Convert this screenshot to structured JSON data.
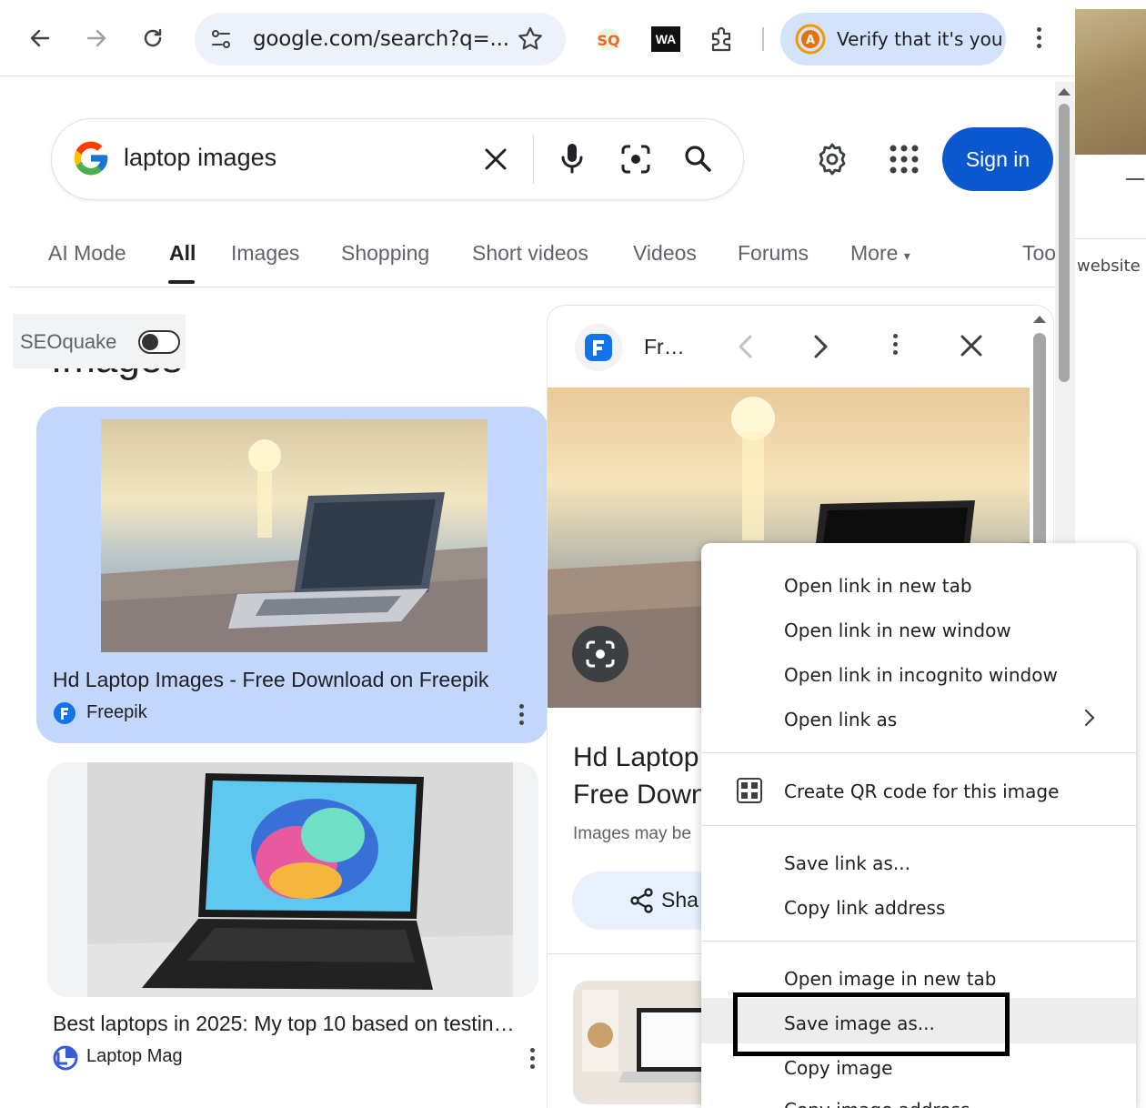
{
  "browser": {
    "address": "google.com/search?q=...",
    "verify_label": "Verify that it's you",
    "extensions": {
      "wa_label": "WA",
      "seo_label": "SQ"
    },
    "side_text": "website"
  },
  "search": {
    "query": "laptop images",
    "sign_in_label": "Sign in"
  },
  "tabs": {
    "ai_mode": "AI Mode",
    "all": "All",
    "images": "Images",
    "shopping": "Shopping",
    "short_videos": "Short videos",
    "videos": "Videos",
    "forums": "Forums",
    "more": "More",
    "tools": "Too"
  },
  "seoquake": {
    "label": "SEOquake",
    "enabled": false
  },
  "section_heading": "Images",
  "results": [
    {
      "title": "Hd Laptop Images - Free Download on Freepik",
      "source": "Freepik"
    },
    {
      "title": "Best laptops in 2025: My top 10 based on testin…",
      "source": "Laptop Mag"
    }
  ],
  "panel": {
    "source_short": "Fr…",
    "title_line1": "Hd Laptop",
    "title_line2": "Free Down",
    "note": "Images may be",
    "share_label": "Sha"
  },
  "context_menu": {
    "items": [
      "Open link in new tab",
      "Open link in new window",
      "Open link in incognito window",
      "Open link as",
      "Create QR code for this image",
      "Save link as...",
      "Copy link address",
      "Open image in new tab",
      "Save image as...",
      "Copy image",
      "Copy image address"
    ],
    "highlighted": "Save image as..."
  },
  "colors": {
    "accent_blue": "#0b57d0",
    "selected_card": "#c2d7fb",
    "verify_pill": "#d3e3fd"
  }
}
